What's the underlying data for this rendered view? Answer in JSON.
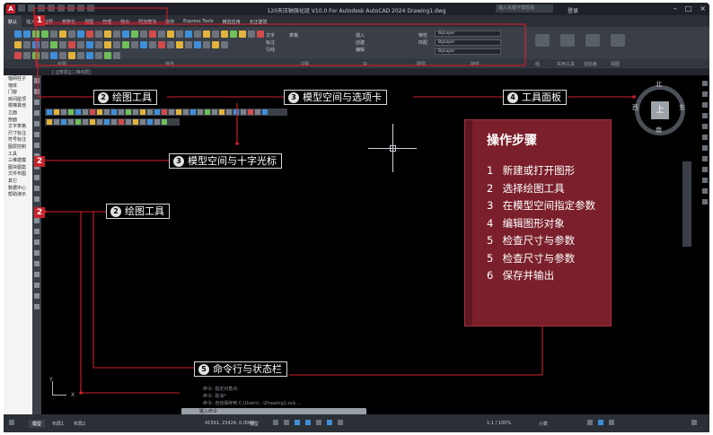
{
  "window": {
    "logo": "A",
    "title": "120天压轴强化班 V10.0 For Autodesk AutoCAD 2024 Drawing1.dwg",
    "search_placeholder": "输入关键字或短语",
    "user": "登录",
    "share": "共享"
  },
  "tabs": [
    "默认",
    "插入",
    "注释",
    "参数化",
    "视图",
    "管理",
    "输出",
    "附加模块",
    "协作",
    "Express Tools",
    "精选应用",
    "天正建筑"
  ],
  "active_tab": "默认",
  "ribbon": {
    "dropdowns": {
      "layer": "ByLayer",
      "linetype": "ByLayer",
      "lineweight": "ByLayer"
    },
    "labels": {
      "draw": "绘图",
      "modify": "修改",
      "annotation": "注释",
      "layers": "图层",
      "block": "块",
      "properties": "特性",
      "groups": "组",
      "utilities": "实用工具",
      "clipboard": "剪贴板",
      "view": "视图"
    },
    "annot": [
      "文字",
      "标注",
      "引线",
      "表格"
    ],
    "block_btns": [
      "插入",
      "创建",
      "编辑"
    ],
    "prop_btns": [
      "特性",
      "匹配"
    ]
  },
  "view_label": "[-][俯视][二维线框]",
  "side_panel": {
    "items": [
      "轴网柱子",
      "墙体",
      "门窗",
      "房间屋顶",
      "楼梯其他",
      "立面",
      "剖面",
      "文字表格",
      "尺寸标注",
      "符号标注",
      "图层控制",
      "工具",
      "三维建模",
      "图块图案",
      "文件布图",
      "其它",
      "数据中心",
      "帮助演示"
    ]
  },
  "badges": {
    "ribbon": "1",
    "draw_tools_a": "2",
    "draw_tools_b": "2"
  },
  "callouts": [
    {
      "num": "2",
      "label": "绘图工具"
    },
    {
      "num": "3",
      "label": "模型空间与选项卡"
    },
    {
      "num": "4",
      "label": "工具面板"
    },
    {
      "num": "3",
      "label": "模型空间与十字光标"
    },
    {
      "num": "2",
      "label": "绘图工具"
    },
    {
      "num": "5",
      "label": "命令行与状态栏"
    }
  ],
  "panel": {
    "title": "操作步骤",
    "steps": [
      {
        "n": "1",
        "text": "新建或打开图形"
      },
      {
        "n": "2",
        "text": "选择绘图工具"
      },
      {
        "n": "3",
        "text": "在模型空间指定参数"
      },
      {
        "n": "4",
        "text": "编辑图形对象"
      },
      {
        "n": "5",
        "text": "检查尺寸与参数"
      },
      {
        "n": "5",
        "text": "检查尺寸与参数"
      },
      {
        "n": "6",
        "text": "保存并输出"
      }
    ]
  },
  "viewcube": {
    "north": "北",
    "south": "南",
    "east": "东",
    "west": "西",
    "face": "上"
  },
  "ucs": {
    "x": "X",
    "y": "Y"
  },
  "command": {
    "history": [
      "命令: 指定对角点:",
      "命令: 取消*",
      "命令: 自动保存到 C:\\Users\\...\\Drawing1.sv$ ..."
    ],
    "placeholder": "键入命令"
  },
  "status": {
    "tabs": [
      "模型",
      "布局1",
      "布局2"
    ],
    "active": "模型",
    "coords": "41591, 23424, 0.0000",
    "mode": "模型",
    "scale": "1:1 / 100%",
    "units": "小数"
  },
  "colors": {
    "panel_bg": "#7a1f2b",
    "badge": "#c8232c",
    "canvas": "#000000"
  }
}
